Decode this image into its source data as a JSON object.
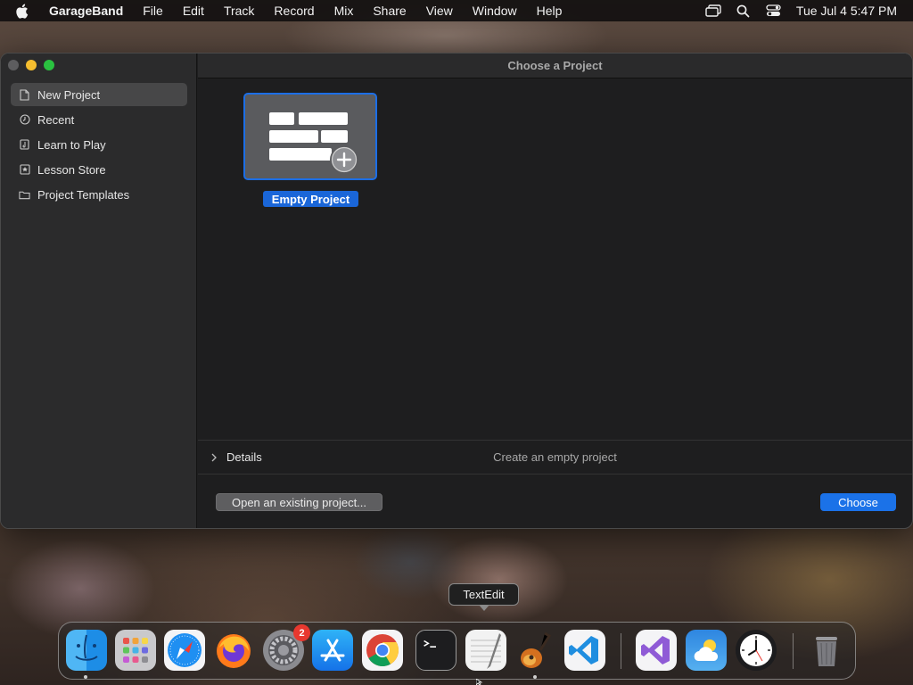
{
  "menubar": {
    "apple_icon": "apple-logo-icon",
    "app_name": "GarageBand",
    "menus": [
      "File",
      "Edit",
      "Track",
      "Record",
      "Mix",
      "Share",
      "View",
      "Window",
      "Help"
    ],
    "status_icons": [
      "screen-mirroring-icon",
      "spotlight-search-icon",
      "control-center-icon"
    ],
    "clock": "Tue Jul 4  5:47 PM"
  },
  "window": {
    "title": "Choose a Project",
    "sidebar": {
      "items": [
        {
          "label": "New Project",
          "icon": "document-icon",
          "selected": true
        },
        {
          "label": "Recent",
          "icon": "clock-icon",
          "selected": false
        },
        {
          "label": "Learn to Play",
          "icon": "music-book-icon",
          "selected": false
        },
        {
          "label": "Lesson Store",
          "icon": "star-box-icon",
          "selected": false
        },
        {
          "label": "Project Templates",
          "icon": "folder-icon",
          "selected": false
        }
      ]
    },
    "templates": [
      {
        "label": "Empty Project",
        "icon": "empty-project-add-icon",
        "selected": true
      }
    ],
    "details": {
      "label": "Details",
      "description": "Create an empty project"
    },
    "open_existing_label": "Open an existing project...",
    "choose_label": "Choose"
  },
  "tooltip": {
    "label": "TextEdit"
  },
  "dock": {
    "apps": [
      {
        "name": "Finder",
        "icon": "finder-icon",
        "running": true
      },
      {
        "name": "Launchpad",
        "icon": "launchpad-icon",
        "running": false
      },
      {
        "name": "Safari",
        "icon": "safari-icon",
        "running": false
      },
      {
        "name": "Firefox",
        "icon": "firefox-icon",
        "running": false
      },
      {
        "name": "System Settings",
        "icon": "system-settings-icon",
        "running": false,
        "badge": "2"
      },
      {
        "name": "App Store",
        "icon": "app-store-icon",
        "running": false
      },
      {
        "name": "Chrome",
        "icon": "chrome-icon",
        "running": false
      },
      {
        "name": "Terminal",
        "icon": "terminal-icon",
        "running": false
      },
      {
        "name": "TextEdit",
        "icon": "textedit-icon",
        "running": false
      },
      {
        "name": "GarageBand",
        "icon": "garageband-icon",
        "running": true
      },
      {
        "name": "Visual Studio Code",
        "icon": "vscode-icon",
        "running": false
      },
      {
        "name": "Visual Studio",
        "icon": "visual-studio-icon",
        "running": false
      },
      {
        "name": "Weather",
        "icon": "weather-icon",
        "running": false
      },
      {
        "name": "Clock",
        "icon": "clock-app-icon",
        "running": false
      },
      {
        "name": "Trash",
        "icon": "trash-icon",
        "running": false
      }
    ]
  },
  "colors": {
    "accent": "#1b72e8",
    "window_bg": "#1e1e1f",
    "sidebar_bg": "#2b2b2c",
    "traffic_close": "#5d5d5f",
    "traffic_minimize": "#f5bd2f",
    "traffic_maximize": "#2ac240",
    "badge": "#e8382f"
  }
}
